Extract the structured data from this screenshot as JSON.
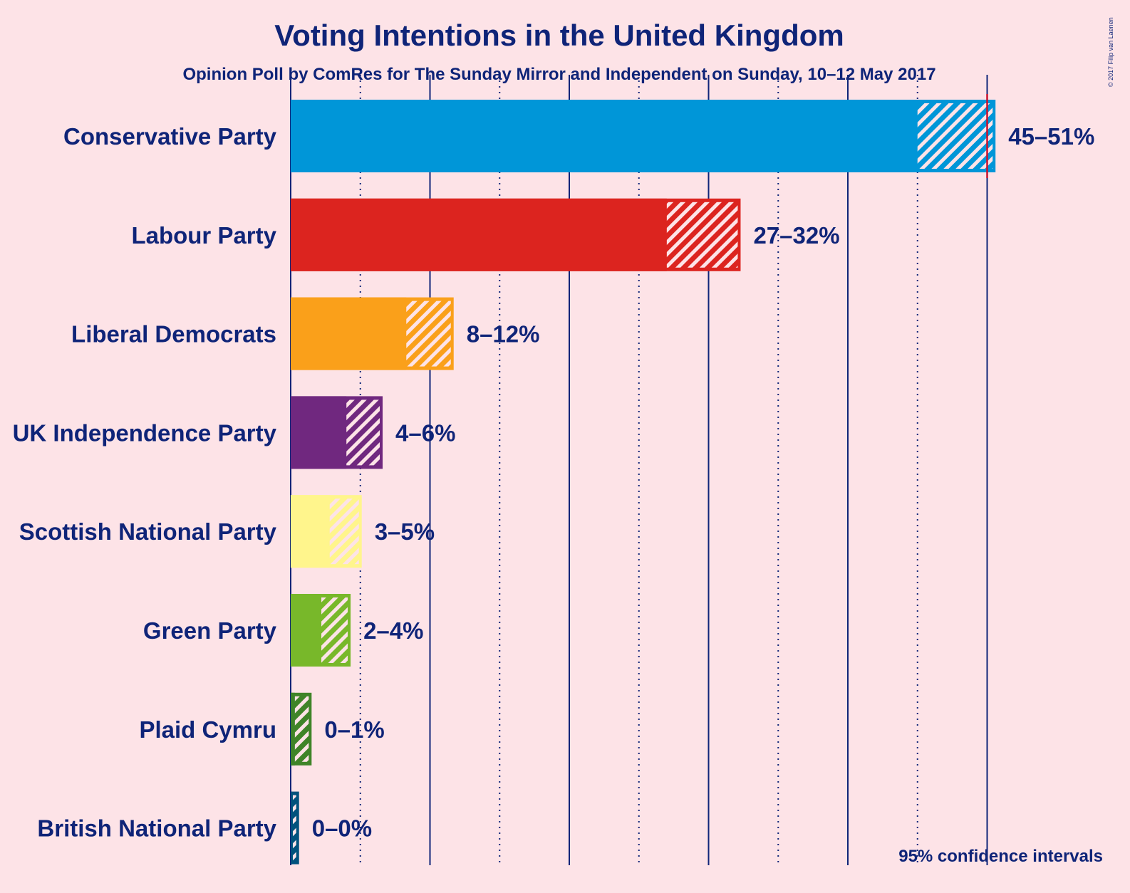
{
  "chart_data": {
    "type": "bar",
    "orientation": "horizontal",
    "title": "Voting Intentions in the United Kingdom",
    "subtitle": "Opinion Poll by ComRes for The Sunday Mirror and Independent on Sunday, 10–12 May 2017",
    "xlabel": "",
    "ylabel": "",
    "xlim": [
      0,
      52
    ],
    "major_gridlines": [
      0,
      10,
      20,
      30,
      40,
      50
    ],
    "minor_gridlines": [
      5,
      15,
      25,
      35,
      45
    ],
    "grid": true,
    "marker_line": {
      "value": 50,
      "color": "#c8102e"
    },
    "note": "95% confidence intervals",
    "copyright": "© 2017 Filip van Laenen",
    "series": [
      {
        "name": "Conservative Party",
        "low": 45.0,
        "high": 50.6,
        "label": "45–51%",
        "color": "#0096d8"
      },
      {
        "name": "Labour Party",
        "low": 27.0,
        "high": 32.3,
        "label": "27–32%",
        "color": "#dc241f"
      },
      {
        "name": "Liberal Democrats",
        "low": 8.3,
        "high": 11.7,
        "label": "8–12%",
        "color": "#faa01a"
      },
      {
        "name": "UK Independence Party",
        "low": 4.0,
        "high": 6.6,
        "label": "4–6%",
        "color": "#70287f"
      },
      {
        "name": "Scottish National Party",
        "low": 2.8,
        "high": 5.1,
        "label": "3–5%",
        "color": "#fff58c"
      },
      {
        "name": "Green Party",
        "low": 2.2,
        "high": 4.3,
        "label": "2–4%",
        "color": "#78b82a"
      },
      {
        "name": "Plaid Cymru",
        "low": 0.3,
        "high": 1.5,
        "label": "0–1%",
        "color": "#3f8428"
      },
      {
        "name": "British National Party",
        "low": 0.1,
        "high": 0.6,
        "label": "0–0%",
        "color": "#00527d"
      }
    ]
  }
}
